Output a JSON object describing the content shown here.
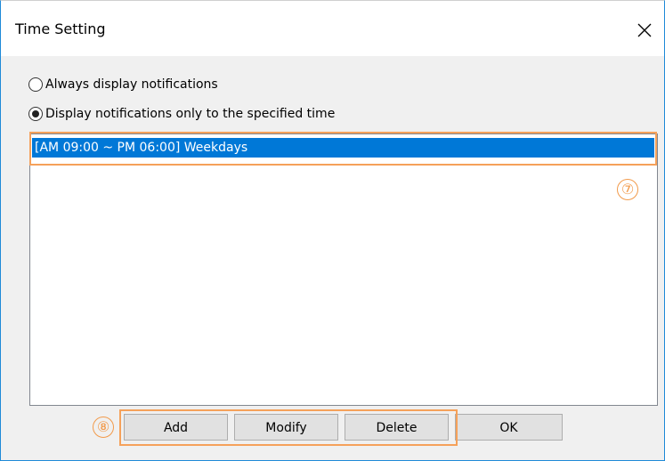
{
  "window": {
    "title": "Time Setting"
  },
  "options": {
    "always": {
      "label": "Always display notifications",
      "checked": false
    },
    "specified": {
      "label": "Display notifications only to the specified time",
      "checked": true
    }
  },
  "schedule_list": {
    "items": [
      {
        "label": "[AM 09:00 ~ PM 06:00] Weekdays",
        "selected": true
      }
    ]
  },
  "callouts": {
    "list_marker": "⑦",
    "buttons_marker": "⑧"
  },
  "buttons": {
    "add": "Add",
    "modify": "Modify",
    "delete": "Delete",
    "ok": "OK"
  },
  "colors": {
    "selection": "#0078d7",
    "callout": "#f5a15a",
    "window_border": "#1f8ad8"
  },
  "icons": {
    "close": "close-icon"
  }
}
